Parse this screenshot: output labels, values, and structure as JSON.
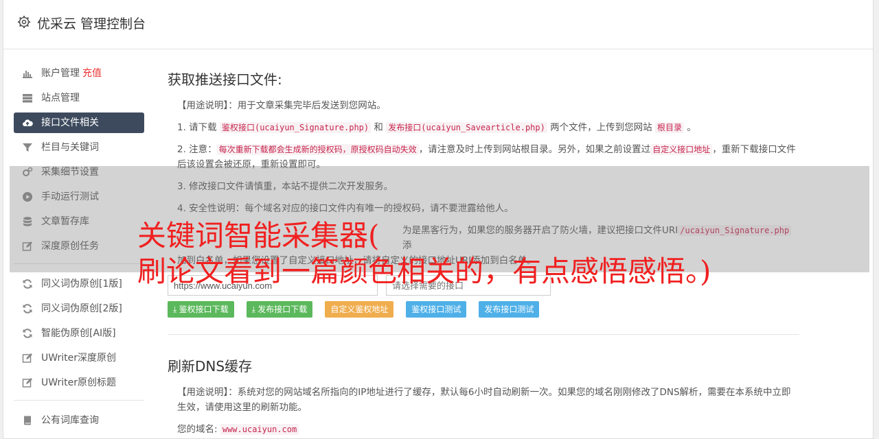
{
  "header": {
    "title": "优采云 管理控制台"
  },
  "sidebar": {
    "group1": [
      {
        "label": "账户管理",
        "extra": "充值",
        "icon": "bar-chart-icon"
      },
      {
        "label": "站点管理",
        "icon": "server-icon"
      },
      {
        "label": "接口文件相关",
        "icon": "cloud-upload-icon",
        "active": true
      },
      {
        "label": "栏目与关键词",
        "icon": "filter-icon"
      },
      {
        "label": "采集细节设置",
        "icon": "cogs-icon"
      },
      {
        "label": "手动运行测试",
        "icon": "play-icon"
      },
      {
        "label": "文章暂存库",
        "icon": "database-icon"
      },
      {
        "label": "深度原创任务",
        "icon": "edit-icon"
      }
    ],
    "group2": [
      {
        "label": "同义词伪原创[1版]",
        "icon": "refresh-icon"
      },
      {
        "label": "同义词伪原创[2版]",
        "icon": "refresh-icon"
      },
      {
        "label": "智能伪原创[AI版]",
        "icon": "refresh-icon"
      },
      {
        "label": "UWriter深度原创",
        "icon": "edit-icon"
      },
      {
        "label": "UWriter原创标题",
        "icon": "edit-icon"
      }
    ],
    "group3": [
      {
        "label": "公有词库查询",
        "icon": "book-icon"
      }
    ]
  },
  "section1": {
    "title": "获取推送接口文件:",
    "usage_label": "【用途说明】",
    "usage_text": "：用于文章采集完毕后发送到您网站。",
    "p1_a": "1. 请下载 ",
    "p1_code1": "鉴权接口(ucaiyun_Signature.php)",
    "p1_b": " 和 ",
    "p1_code2": "发布接口(ucaiyun_Savearticle.php)",
    "p1_c": " 两个文件，上传到您网站 ",
    "p1_code3": "根目录",
    "p1_d": " 。",
    "p2_a": "2. 注意：",
    "p2_code1": "每次重新下载都会生成新的授权码，原授权码自动失效",
    "p2_b": "，请注意及时上传到网站根目录。另外，如果之前设置过",
    "p2_code2": "自定义接口地址",
    "p2_c": "，重新下载接口文件后该设置会被还原，重新设置即可。",
    "p3": "3. 修改接口文件请慎重，本站不提供二次开发服务。",
    "p4": "4. 安全性说明：每个域名对应的接口文件内有唯一的授权码，请不要泄露给他人。",
    "p5_a": "为是黑客行为，如果您的服务器开启了防火墙，建议把接口文件URI",
    "p5_code": "/ucaiyun_Signature.php",
    "p5_b": "添",
    "p5_c": "加到白名单，如果您设置了自定义接口地址，请将自定义的接口地址URI添加到白名单。",
    "input_url_value": "https://www.ucaiyun.com",
    "input_port_placeholder": "请选择需要的接口",
    "buttons": {
      "sig_download": "鉴权接口下载",
      "pub_download": "发布接口下载",
      "custom_sig": "自定义鉴权地址",
      "sig_test": "鉴权接口测试",
      "pub_test": "发布接口测试"
    }
  },
  "section2": {
    "title": "刷新DNS缓存",
    "usage_label": "【用途说明】",
    "usage_text": "：系统对您的网站域名所指向的IP地址进行了缓存，默认每6小时自动刷新一次。如果您的域名刚刚修改了DNS解析，需要在本系统中立即生效，请使用这里的刷新功能。",
    "domain_label": "您的域名:",
    "domain_value": "www.ucaiyun.com"
  },
  "overlay": {
    "line1": "关键词智能采集器(",
    "line2": "刷论文看到一篇颜色相关的，有点感悟感悟。)"
  },
  "colors": {
    "active_nav": "#3d4a5d",
    "green": "#5cb85c",
    "orange": "#f0ad4e",
    "blue": "#4fb0e8",
    "overlay_text": "#f02020"
  }
}
